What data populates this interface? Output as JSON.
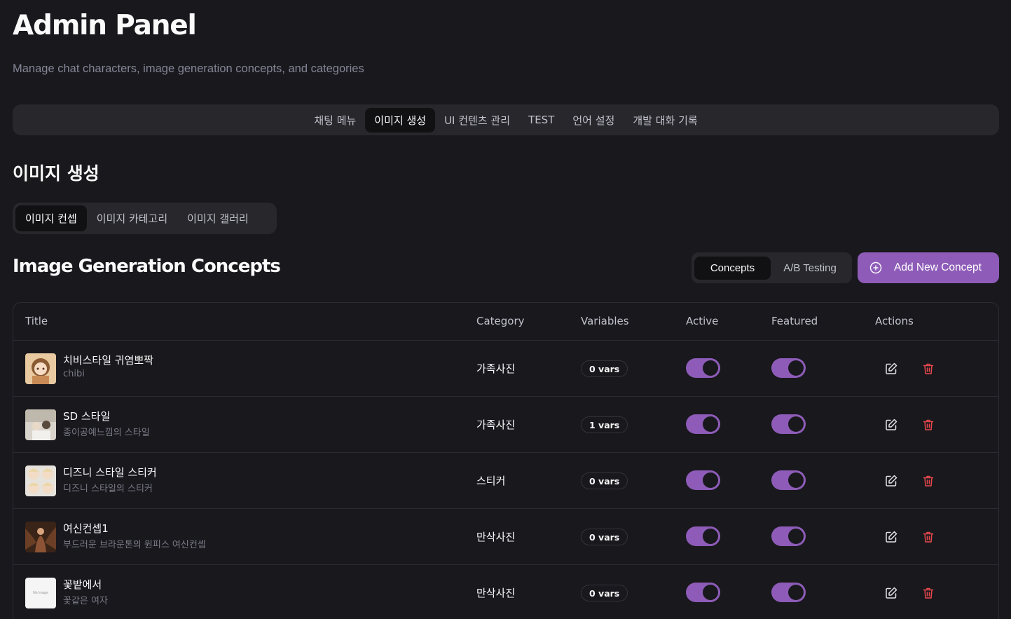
{
  "header": {
    "title": "Admin Panel",
    "subtitle": "Manage chat characters, image generation concepts, and categories"
  },
  "main_tabs": [
    {
      "label": "채팅 메뉴",
      "active": false
    },
    {
      "label": "이미지 생성",
      "active": true
    },
    {
      "label": "UI 컨텐츠 관리",
      "active": false
    },
    {
      "label": "TEST",
      "active": false
    },
    {
      "label": "언어 설정",
      "active": false
    },
    {
      "label": "개발 대화 기록",
      "active": false
    }
  ],
  "section": {
    "title": "이미지 생성"
  },
  "sub_tabs": [
    {
      "label": "이미지 컨셉",
      "active": true
    },
    {
      "label": "이미지 카테고리",
      "active": false
    },
    {
      "label": "이미지 갤러리",
      "active": false
    }
  ],
  "concepts": {
    "title": "Image Generation Concepts",
    "view_toggle": {
      "concepts": "Concepts",
      "ab_testing": "A/B Testing"
    },
    "add_button": "Add New Concept"
  },
  "table": {
    "headers": {
      "title": "Title",
      "category": "Category",
      "variables": "Variables",
      "active": "Active",
      "featured": "Featured",
      "actions": "Actions"
    },
    "rows": [
      {
        "title": "치비스타일 귀염뽀짝",
        "subtitle": "chibi",
        "category": "가족사진",
        "vars": "0 vars",
        "active": true,
        "featured": true,
        "thumb": "chibi-girl"
      },
      {
        "title": "SD 스타일",
        "subtitle": "종이공예느낌의 스타일",
        "category": "가족사진",
        "vars": "1 vars",
        "active": true,
        "featured": true,
        "thumb": "family-photo"
      },
      {
        "title": "디즈니 스타일 스티커",
        "subtitle": "디즈니 스타일의 스티커",
        "category": "스티커",
        "vars": "0 vars",
        "active": true,
        "featured": true,
        "thumb": "sticker-grid"
      },
      {
        "title": "여신컨셉1",
        "subtitle": "부드러운 브라운톤의 원피스 여신컨셉",
        "category": "만삭사진",
        "vars": "0 vars",
        "active": true,
        "featured": true,
        "thumb": "goddess"
      },
      {
        "title": "꽃밭에서",
        "subtitle": "꽃같은 여자",
        "category": "만삭사진",
        "vars": "0 vars",
        "active": true,
        "featured": true,
        "thumb": "no-image",
        "thumb_text": "No Image"
      }
    ]
  },
  "colors": {
    "background": "#18181d",
    "accent": "#8e5cb8",
    "delete": "#e5484d"
  }
}
